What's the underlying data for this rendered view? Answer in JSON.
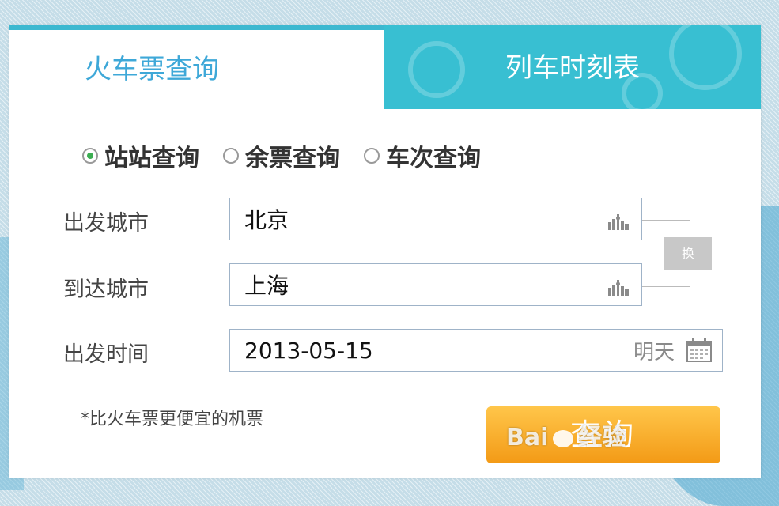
{
  "tabs": {
    "train_ticket": "火车票查询",
    "timetable": "列车时刻表"
  },
  "query_modes": [
    {
      "label": "站站查询",
      "checked": true
    },
    {
      "label": "余票查询",
      "checked": false
    },
    {
      "label": "车次查询",
      "checked": false
    }
  ],
  "form": {
    "from_label": "出发城市",
    "from_value": "北京",
    "to_label": "到达城市",
    "to_value": "上海",
    "swap_label": "换",
    "date_label": "出发时间",
    "date_value": "2013-05-15",
    "date_suffix": "明天"
  },
  "note": "*比火车票更便宜的机票",
  "search_label": "查询",
  "watermark": {
    "left": "Bai",
    "right": "经验"
  },
  "colors": {
    "tab_active_text": "#3ea8d8",
    "tab_inactive_bg": "#38bfd2",
    "radio_checked": "#3cae52",
    "search_button": "#f5a623"
  }
}
